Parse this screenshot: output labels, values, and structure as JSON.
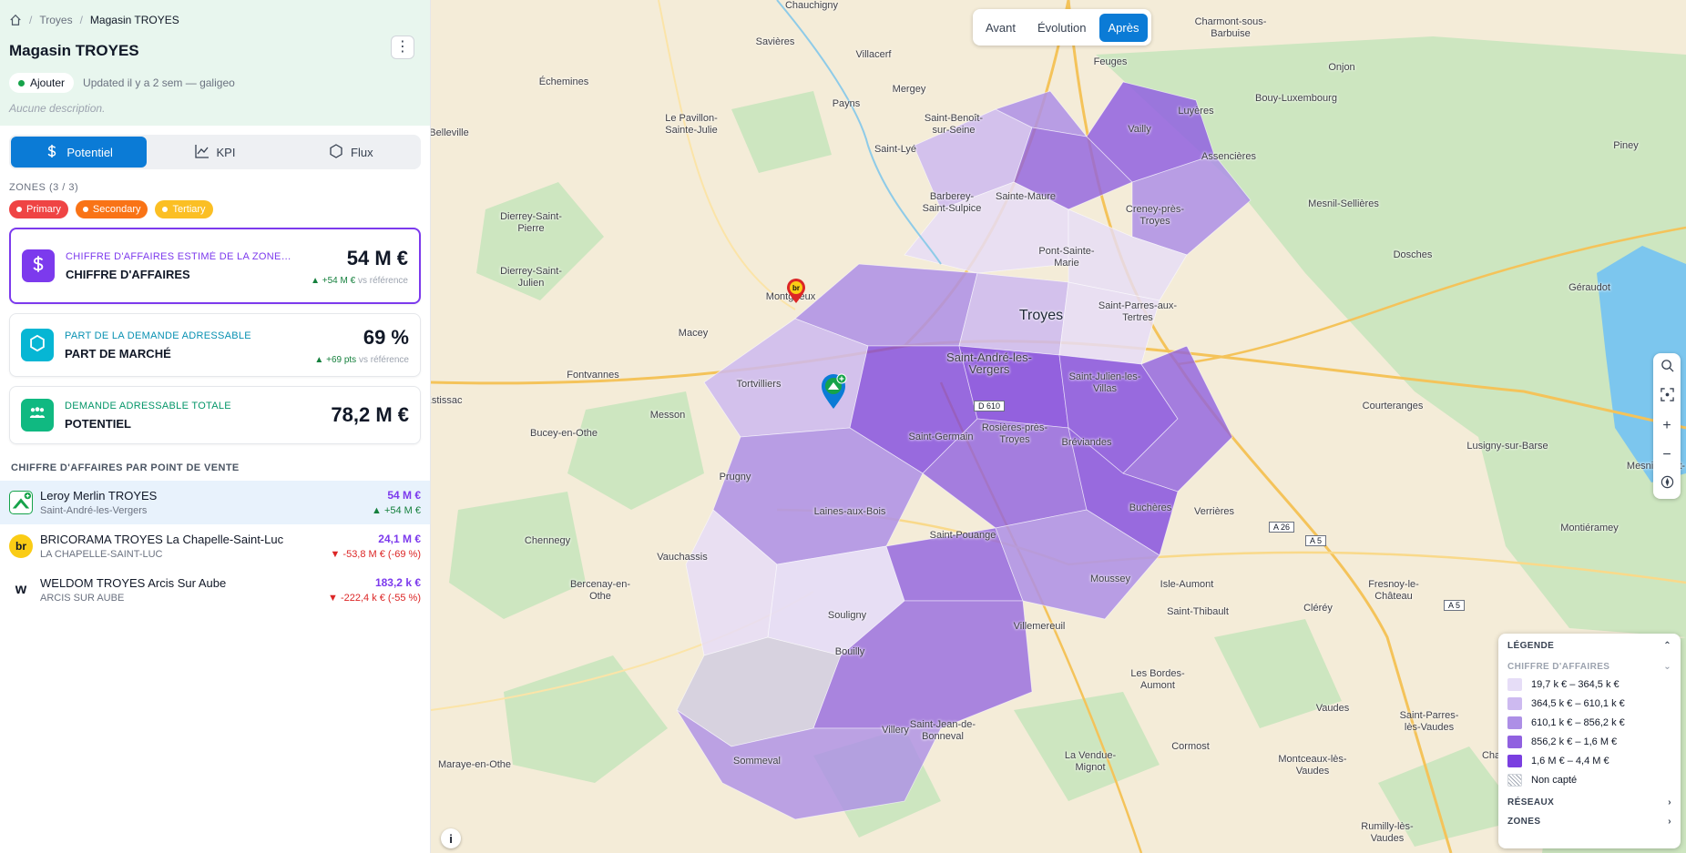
{
  "breadcrumb": {
    "items": [
      "Troyes"
    ],
    "current": "Magasin TROYES"
  },
  "header": {
    "title": "Magasin TROYES",
    "status_label": "Ajouter",
    "status_color": "#16a34a",
    "updated": "Updated il y a 2 sem — galigeo",
    "description": "Aucune description."
  },
  "tabs": [
    {
      "label": "Potentiel",
      "icon": "dollar-icon"
    },
    {
      "label": "KPI",
      "icon": "line-chart-icon"
    },
    {
      "label": "Flux",
      "icon": "hexagon-icon"
    }
  ],
  "zones": {
    "label": "ZONES (3 / 3)",
    "items": [
      {
        "label": "Primary",
        "color": "#ef4444"
      },
      {
        "label": "Secondary",
        "color": "#f97316"
      },
      {
        "label": "Tertiary",
        "color": "#fbbf24"
      }
    ]
  },
  "kpis": [
    {
      "sub": "CHIFFRE D'AFFAIRES ESTIMÉ DE LA ZONE ...",
      "main": "CHIFFRE D'AFFAIRES",
      "value": "54 M €",
      "delta": "▲ +54 M €",
      "ref": "vs référence",
      "color": "#7c3aed",
      "icon": "dollar-icon"
    },
    {
      "sub": "PART DE LA DEMANDE ADRESSABLE",
      "main": "PART DE MARCHÉ",
      "value": "69 %",
      "delta": "▲ +69 pts",
      "ref": "vs référence",
      "color": "#06b6d4",
      "icon": "hexagon-icon"
    },
    {
      "sub": "DEMANDE ADRESSABLE TOTALE",
      "main": "POTENTIEL",
      "value": "78,2 M €",
      "delta": "",
      "ref": "",
      "color": "#10b981",
      "icon": "people-icon"
    }
  ],
  "pos": {
    "title": "CHIFFRE D'AFFAIRES PAR POINT DE VENTE",
    "items": [
      {
        "name": "Leroy Merlin TROYES",
        "city": "Saint-André-les-Vergers",
        "value": "54 M €",
        "delta": "▲ +54 M €",
        "dir": "up",
        "logo": "LM"
      },
      {
        "name": "BRICORAMA TROYES La Chapelle-Saint-Luc",
        "city": "LA CHAPELLE-SAINT-LUC",
        "value": "24,1 M €",
        "delta": "▼ -53,8 M € (-69 %)",
        "dir": "down",
        "logo": "br"
      },
      {
        "name": "WELDOM TROYES Arcis Sur Aube",
        "city": "ARCIS SUR AUBE",
        "value": "183,2 k €",
        "delta": "▼ -222,4 k € (-55 %)",
        "dir": "down",
        "logo": "w"
      }
    ]
  },
  "period": {
    "options": [
      "Avant",
      "Évolution",
      "Après"
    ],
    "selected": "Après"
  },
  "legend": {
    "title": "LÉGENDE",
    "section": "CHIFFRE D'AFFAIRES",
    "items": [
      {
        "label": "19,7 k € – 364,5 k €",
        "color": "#e6ddf7"
      },
      {
        "label": "364,5 k € – 610,1 k €",
        "color": "#cdbaf0"
      },
      {
        "label": "610,1 k € – 856,2 k €",
        "color": "#ad8fe6"
      },
      {
        "label": "856,2 k € – 1,6 M €",
        "color": "#9061e0"
      },
      {
        "label": "1,6 M € – 4,4 M €",
        "color": "#7a3fe0"
      }
    ],
    "non_capte": "Non capté",
    "footer": [
      "RÉSEAUX",
      "ZONES"
    ]
  },
  "map": {
    "places": [
      "Chauchigny",
      "Savières",
      "Villacerf",
      "Charmont-sous-Barbuise",
      "Échemines",
      "Mergey",
      "Feuges",
      "Onjon",
      "Payns",
      "Saint-Benoît-sur-Seine",
      "Bouy-Luxembourg",
      "Luyères",
      "Le Pavillon-Sainte-Julie",
      "Vailly",
      "Belleville",
      "Saint-Lyé",
      "Assencières",
      "Piney",
      "Sainte-Maure",
      "Barberey-Saint-Sulpice",
      "Creney-près-Troyes",
      "Mesnil-Sellières",
      "Dierrey-Saint-Pierre",
      "Dosches",
      "Pont-Sainte-Marie",
      "Dierrey-Saint-Julien",
      "Géraudot",
      "Montgueux",
      "Troyes",
      "Saint-Parres-aux-Tertres",
      "Macey",
      "Saint-André-les-Vergers",
      "Fontvannes",
      "Tortvilliers",
      "Saint-Julien-les-Villas",
      "Courteranges",
      "Lusigny-sur-Barse",
      "Estissac",
      "Messon",
      "Bucey-en-Othe",
      "Rosières-près-Troyes",
      "Saint-Germain",
      "Bréviandes",
      "Mesnil-Saint-",
      "Prugny",
      "Buchères",
      "Verrières",
      "Laines-aux-Bois",
      "Montiéramey",
      "Chennegy",
      "Saint-Pouange",
      "Vauchassis",
      "Moussey",
      "Isle-Aumont",
      "Fresnoy-le-Château",
      "Bercenay-en-Othe",
      "Saint-Thibault",
      "Cléréy",
      "Souligny",
      "Villemereuil",
      "Bouilly",
      "Les Bordes-Aumont",
      "Vaudes",
      "Saint-Parres-lès-Vaudes",
      "Chappes",
      "Saint-Jean-de-Bonneval",
      "Villery",
      "Cormost",
      "Maraye-en-Othe",
      "La Vendue-Mignot",
      "Sommeval",
      "Montceaux-lès-Vaudes",
      "Rumilly-lès-Vaudes"
    ],
    "roads": [
      "A 26",
      "A 5",
      "A 5",
      "D 610"
    ]
  }
}
